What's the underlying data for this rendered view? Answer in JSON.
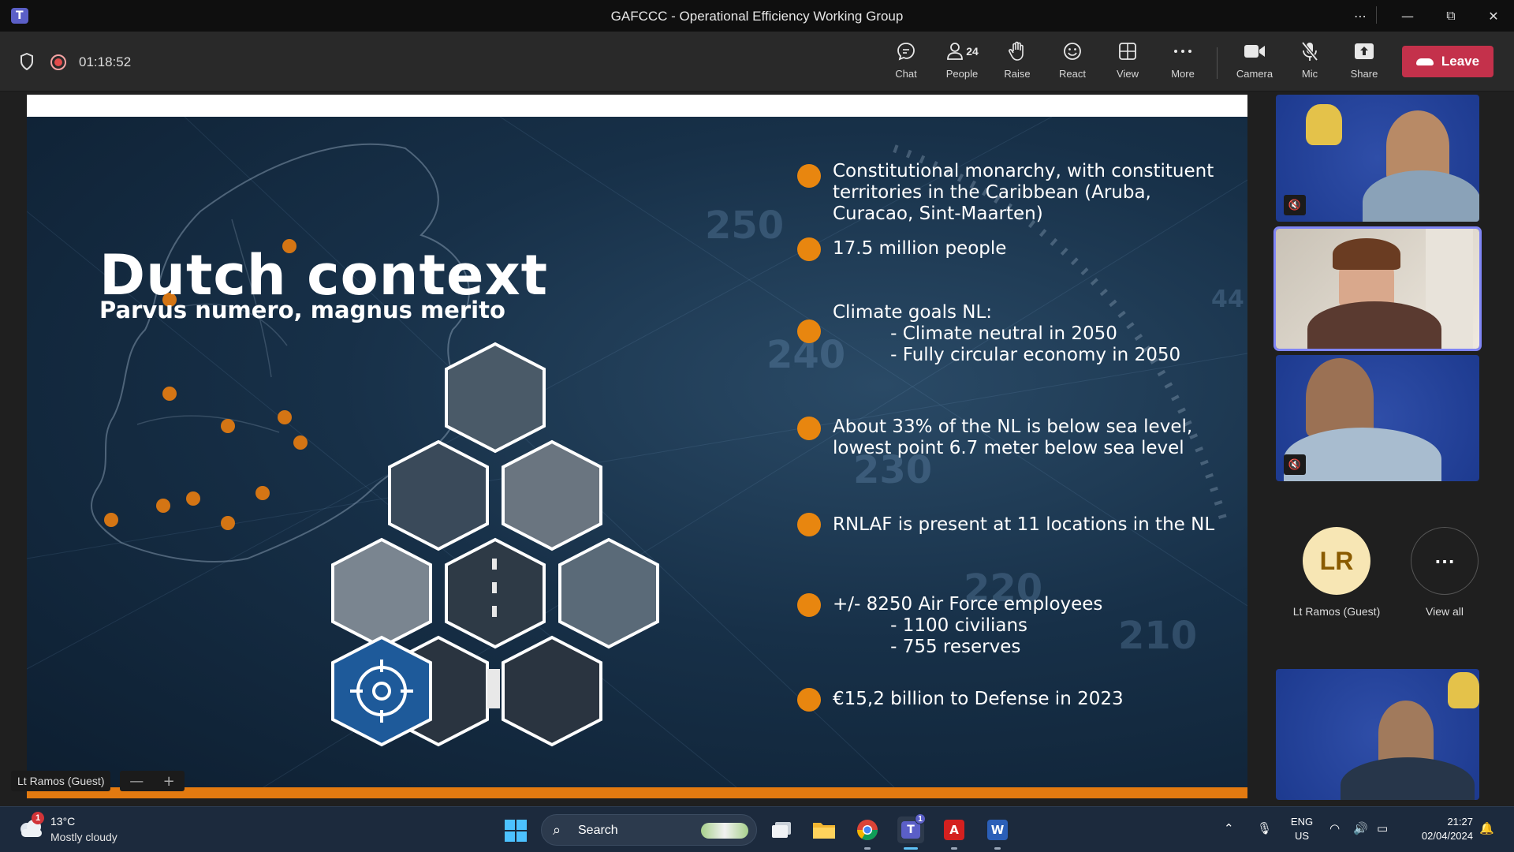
{
  "window": {
    "title": "GAFCCC - Operational Efficiency Working Group",
    "more_icon": "⋯",
    "minimize_icon": "—",
    "restore_icon": "⧉",
    "close_icon": "✕"
  },
  "meeting": {
    "timer": "01:18:52",
    "recording": true
  },
  "toolbar": {
    "chat_label": "Chat",
    "people_label": "People",
    "people_count": "24",
    "raise_label": "Raise",
    "react_label": "React",
    "view_label": "View",
    "more_label": "More",
    "camera_label": "Camera",
    "mic_label": "Mic",
    "share_label": "Share",
    "leave_label": "Leave"
  },
  "slide": {
    "title": "Dutch context",
    "subtitle": "Parvus numero, magnus merito",
    "bullets": [
      "Constitutional monarchy, with constituent\nterritories in the Caribbean (Aruba,\nCuracao, Sint-Maarten)",
      "17.5 million people",
      "Climate goals NL:\n          - Climate neutral in 2050\n          - Fully circular economy in 2050",
      "About 33% of the NL is below sea level,\nlowest point 6.7 meter below sea level",
      "RNLAF is present at 11 locations in the NL",
      "+/- 8250 Air Force employees\n          - 1100 civilians\n          - 755 reserves",
      "€15,2 billion to Defense in 2023"
    ],
    "gauge_numbers": [
      "250",
      "240",
      "230",
      "220",
      "210",
      "44"
    ]
  },
  "stage": {
    "presenter_name": "Lt Ramos (Guest)",
    "zoom_out": "—",
    "zoom_in": "+"
  },
  "gallery": {
    "avatar_initials": "LR",
    "avatar_name": "Lt Ramos (Guest)",
    "view_all_label": "View all",
    "view_all_icon": "⋯",
    "mic_off_icon": "🔇"
  },
  "taskbar": {
    "weather_temp": "13°C",
    "weather_desc": "Mostly cloudy",
    "weather_badge": "1",
    "search_placeholder": "Search",
    "teams_badge": "1",
    "lang_line1": "ENG",
    "lang_line2": "US",
    "time": "21:27",
    "date": "02/04/2024"
  },
  "colors": {
    "leave": "#c4314b",
    "bullet": "#e8860f",
    "speaking_border": "#7f85f5",
    "avatar_bg": "#f7e6b4",
    "avatar_text": "#8a5b00"
  }
}
